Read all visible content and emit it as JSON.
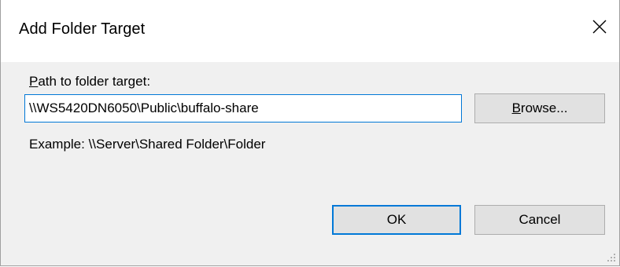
{
  "dialog": {
    "title": "Add Folder Target",
    "close_icon": "close-icon"
  },
  "form": {
    "path_label_accel": "P",
    "path_label_rest": "ath to folder target:",
    "path_value": "\\\\WS5420DN6050\\Public\\buffalo-share",
    "browse_accel": "B",
    "browse_rest": "rowse...",
    "example_text": "Example: \\\\Server\\Shared Folder\\Folder"
  },
  "buttons": {
    "ok_label": "OK",
    "cancel_label": "Cancel"
  },
  "colors": {
    "focus_accent": "#0078d7",
    "dialog_background": "#f0f0f0",
    "button_face": "#e1e1e1"
  }
}
